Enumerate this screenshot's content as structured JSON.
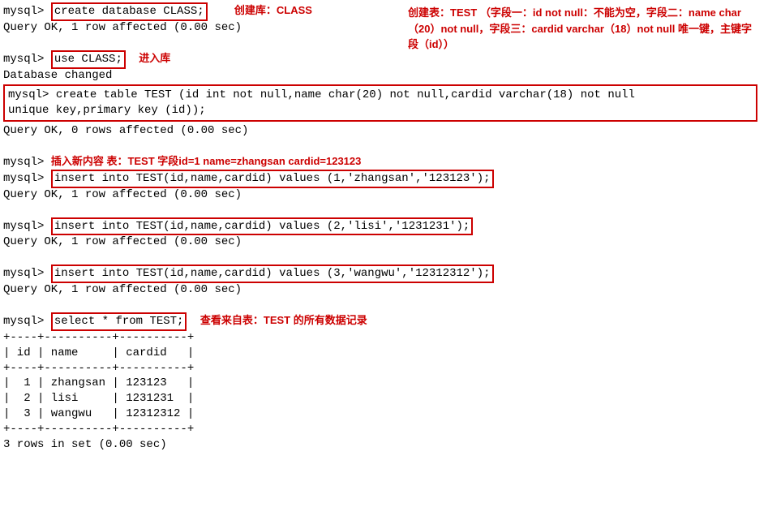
{
  "prompt": "mysql>",
  "cmd": {
    "create_db": "create database CLASS;",
    "use_db": "use CLASS;",
    "create_table_l1": "create table TEST (id int not null,name char(20) not null,cardid varchar(18) not null",
    "create_table_l2": "unique key,primary key (id));",
    "insert1": "insert into TEST(id,name,cardid) values (1,'zhangsan','123123');",
    "insert2": "insert into TEST(id,name,cardid) values (2,'lisi','1231231');",
    "insert3": "insert into TEST(id,name,cardid) values (3,'wangwu','12312312');",
    "select": "select * from TEST;"
  },
  "resp": {
    "one_row": "Query OK, 1 row affected (0.00 sec)",
    "zero_rows": "Query OK, 0 rows affected (0.00 sec)",
    "db_changed": "Database changed",
    "rows_in_set": "3 rows in set (0.00 sec)"
  },
  "ann": {
    "create_db": "创建库：CLASS",
    "use_db": "进入库",
    "create_table": "创建表：TEST （字段一：id not null：不能为空，字段二：name char（20）not null，字段三：cardid varchar（18）not null 唯一键，主键字段（id））",
    "insert_intro": "插入新内容 表：TEST 字段id=1  name=zhangsan  cardid=123123",
    "select": "查看来自表：TEST 的所有数据记录"
  },
  "table_text": "+----+----------+----------+\n| id | name     | cardid   |\n+----+----------+----------+\n|  1 | zhangsan | 123123   |\n|  2 | lisi     | 1231231  |\n|  3 | wangwu   | 12312312 |\n+----+----------+----------+"
}
